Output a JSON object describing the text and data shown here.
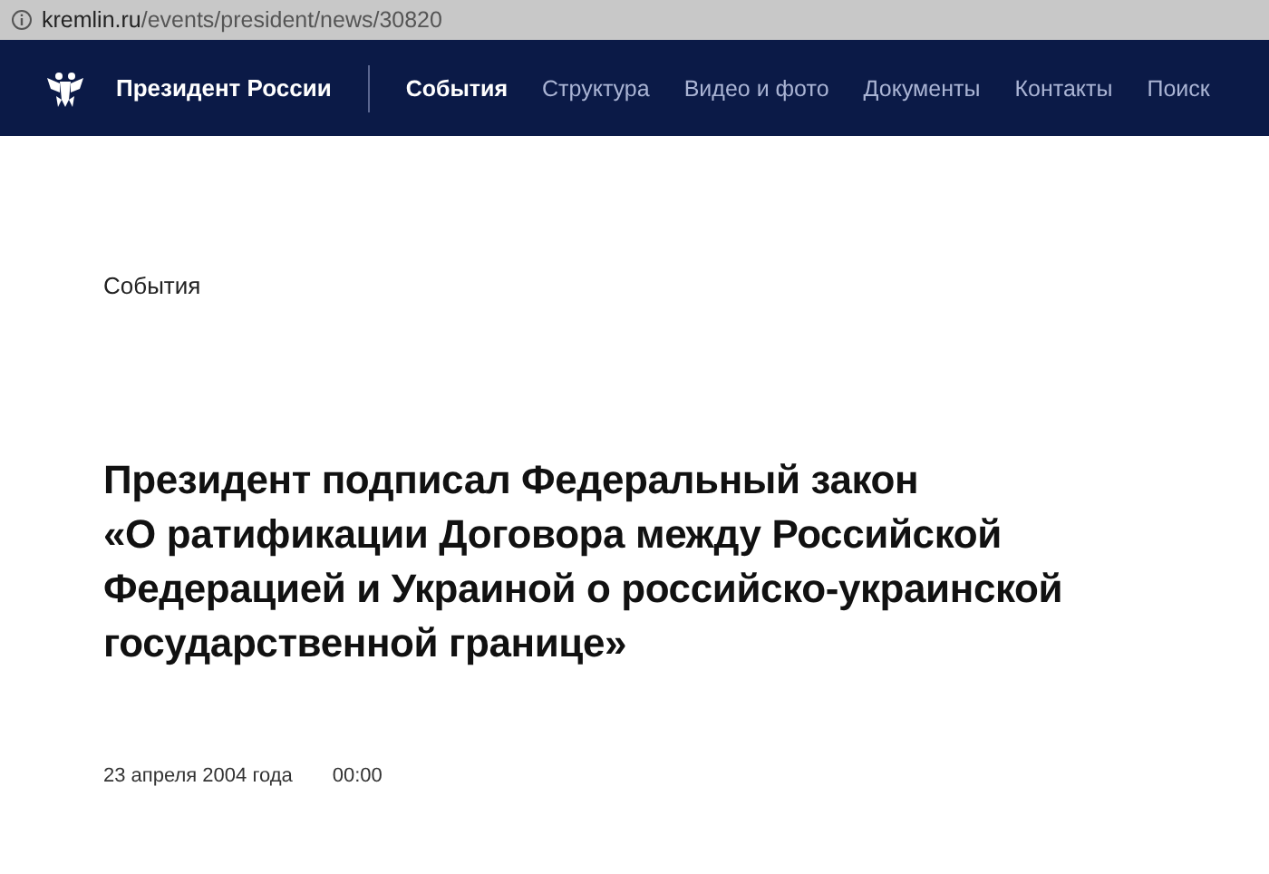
{
  "address_bar": {
    "host": "kremlin.ru",
    "path": "/events/president/news/30820"
  },
  "nav": {
    "site_title": "Президент России",
    "items": [
      {
        "label": "События",
        "selected": true
      },
      {
        "label": "Структура",
        "selected": false
      },
      {
        "label": "Видео и фото",
        "selected": false
      },
      {
        "label": "Документы",
        "selected": false
      },
      {
        "label": "Контакты",
        "selected": false
      },
      {
        "label": "Поиск",
        "selected": false
      }
    ]
  },
  "section": "События",
  "article": {
    "title_lines": [
      "Президент подписал Федеральный закон",
      "«О ратификации Договора между Российской",
      "Федерацией и Украиной о российско-украинской",
      "государственной границе»"
    ],
    "date": "23 апреля 2004 года",
    "time": "00:00"
  }
}
